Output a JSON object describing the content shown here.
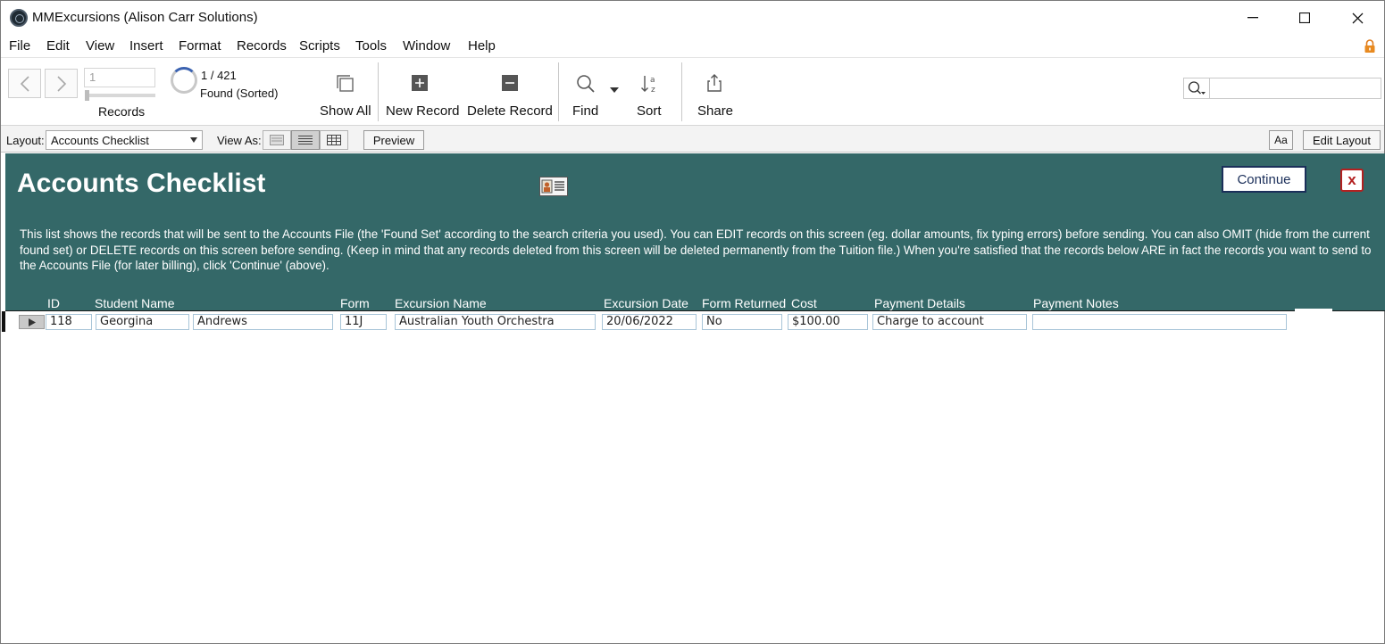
{
  "window": {
    "title": "MMExcursions (Alison Carr Solutions)",
    "minimize": "—",
    "maximize": "☐",
    "close": "✕"
  },
  "menu": [
    "File",
    "Edit",
    "View",
    "Insert",
    "Format",
    "Records",
    "Scripts",
    "Tools",
    "Window",
    "Help"
  ],
  "toolbar": {
    "record_number": "1",
    "records_label": "Records",
    "count": "1 / 421",
    "found_status": "Found (Sorted)",
    "show_all": "Show All",
    "new_record": "New Record",
    "delete_record": "Delete Record",
    "find": "Find",
    "sort": "Sort",
    "share": "Share",
    "search_placeholder": ""
  },
  "layout_bar": {
    "layout_label": "Layout:",
    "layout_value": "Accounts Checklist",
    "view_as_label": "View As:",
    "preview": "Preview",
    "font_button": "Aa",
    "edit_layout": "Edit Layout"
  },
  "page": {
    "title": "Accounts Checklist",
    "continue": "Continue",
    "close": "x",
    "description": "This list shows the records that will be sent to the Accounts File (the 'Found Set' according to the search criteria you used).  You can EDIT records on this screen (eg. dollar amounts, fix typing errors) before sending.  You can also OMIT (hide from the current found set) or DELETE records on this screen before sending.  (Keep in mind that any records deleted from this screen will be deleted permanently from the Tuition file.)  When you're satisfied that the records below ARE in fact the records you want to send to the Accounts File (for later billing), click 'Continue' (above)."
  },
  "columns": {
    "id": "ID",
    "student_name": "Student Name",
    "form": "Form",
    "excursion_name": "Excursion Name",
    "excursion_date": "Excursion Date",
    "form_returned": "Form Returned",
    "cost": "Cost",
    "payment_details": "Payment Details",
    "payment_notes": "Payment Notes"
  },
  "record": {
    "id": "118",
    "first_name": "Georgina",
    "last_name": "Andrews",
    "form": "11J",
    "excursion_name": "Australian Youth Orchestra",
    "excursion_date": "20/06/2022",
    "form_returned": "No",
    "cost": "$100.00",
    "payment_details": "Charge to account",
    "payment_notes": ""
  },
  "colors": {
    "header_band": "#346868",
    "accent_blue": "#1b2f5a",
    "close_red": "#b32020",
    "field_border": "#a8c5d8"
  }
}
